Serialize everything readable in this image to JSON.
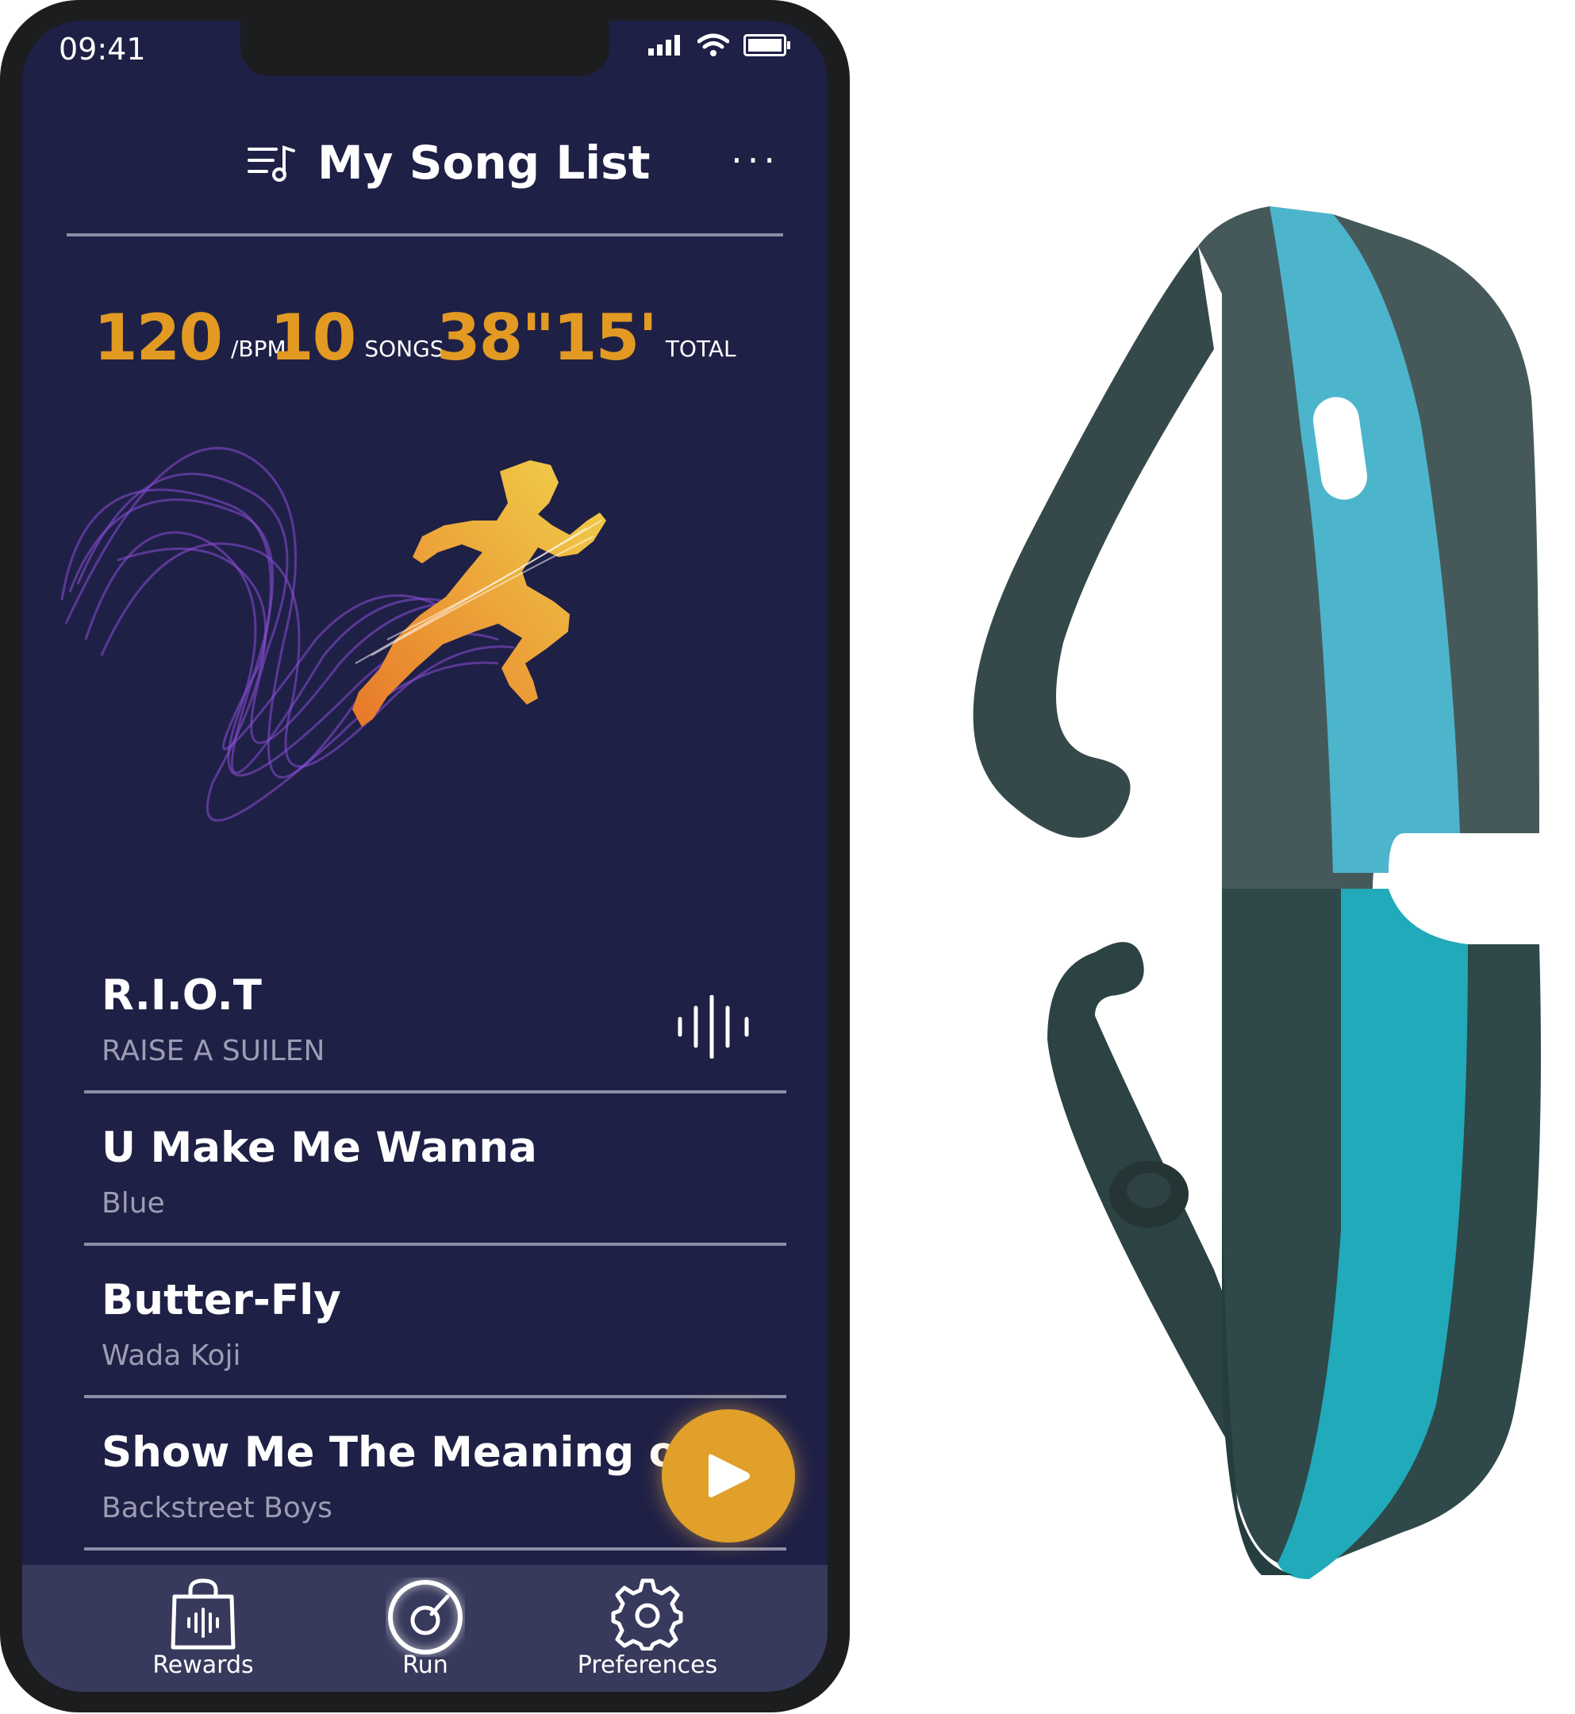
{
  "status_bar": {
    "time": "09:41"
  },
  "header": {
    "title": "My Song List",
    "more_label": "···"
  },
  "stats": [
    {
      "value": "120",
      "unit": "/BPM"
    },
    {
      "value": "10",
      "unit": "SONGS"
    },
    {
      "value": "38\"15'",
      "unit": "TOTAL"
    }
  ],
  "songs": [
    {
      "title": "R.I.O.T",
      "artist": "RAISE A SUILEN"
    },
    {
      "title": "U Make Me Wanna",
      "artist": "Blue"
    },
    {
      "title": "Butter-Fly",
      "artist": "Wada Koji"
    },
    {
      "title": "Show Me The Meaning of",
      "artist": "Backstreet Boys"
    }
  ],
  "tabs": [
    {
      "label": "Rewards",
      "icon": "shopping-bag-icon"
    },
    {
      "label": "Run",
      "icon": "run-disc-icon"
    },
    {
      "label": "Preferences",
      "icon": "gear-icon"
    }
  ],
  "colors": {
    "screen_bg": "#1f2046",
    "accent": "#e29a22",
    "tabbar_bg": "#373a5c",
    "band_dark": "#2f4a4b",
    "band_teal": "#3fb5c8"
  }
}
